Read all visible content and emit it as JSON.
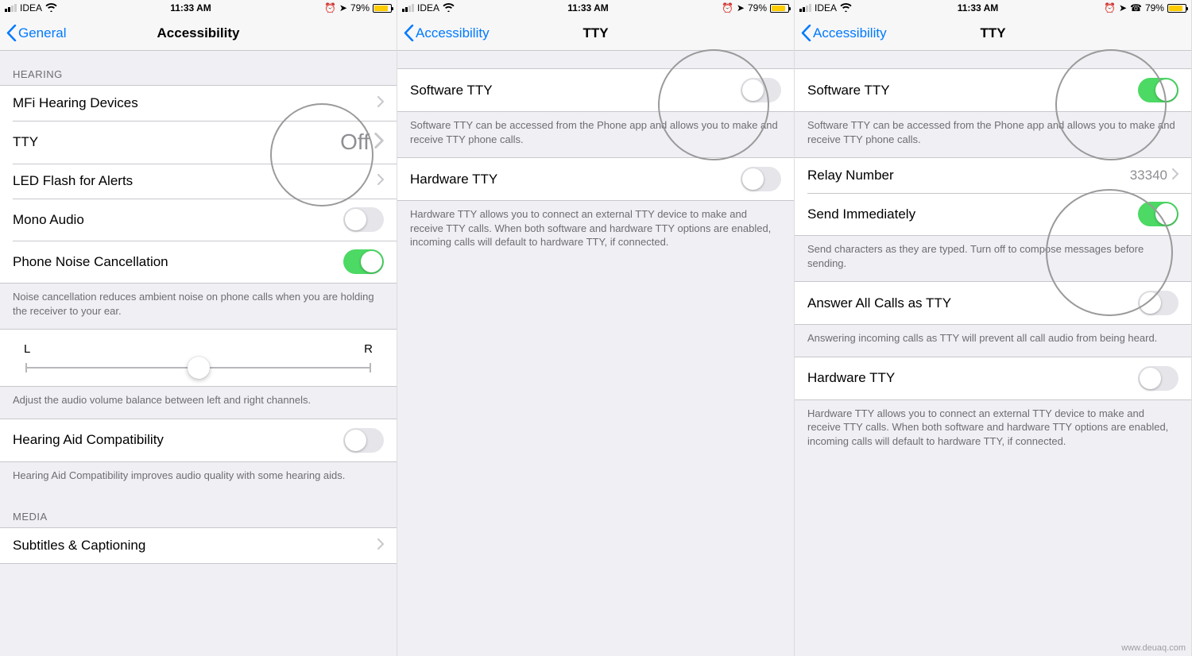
{
  "status": {
    "carrier": "IDEA",
    "time": "11:33 AM",
    "battery_pct": "79%"
  },
  "screen1": {
    "back": "General",
    "title": "Accessibility",
    "section_hearing": "HEARING",
    "mfi": "MFi Hearing Devices",
    "tty": "TTY",
    "tty_value": "Off",
    "led": "LED Flash for Alerts",
    "mono": "Mono Audio",
    "noise": "Phone Noise Cancellation",
    "noise_footer": "Noise cancellation reduces ambient noise on phone calls when you are holding the receiver to your ear.",
    "slider_left": "L",
    "slider_right": "R",
    "slider_footer": "Adjust the audio volume balance between left and right channels.",
    "hearing_aid": "Hearing Aid Compatibility",
    "hearing_aid_footer": "Hearing Aid Compatibility improves audio quality with some hearing aids.",
    "section_media": "MEDIA",
    "subtitles": "Subtitles & Captioning"
  },
  "screen2": {
    "back": "Accessibility",
    "title": "TTY",
    "software_tty": "Software TTY",
    "software_footer": "Software TTY can be accessed from the Phone app and allows you to make and receive TTY phone calls.",
    "hardware_tty": "Hardware TTY",
    "hardware_footer": "Hardware TTY allows you to connect an external TTY device to make and receive TTY calls. When both software and hardware TTY options are enabled, incoming calls will default to hardware TTY, if connected."
  },
  "screen3": {
    "back": "Accessibility",
    "title": "TTY",
    "software_tty": "Software TTY",
    "software_footer": "Software TTY can be accessed from the Phone app and allows you to make and receive TTY phone calls.",
    "relay": "Relay Number",
    "relay_value": "33340",
    "send_immediately": "Send Immediately",
    "send_footer": "Send characters as they are typed. Turn off to compose messages before sending.",
    "answer_all": "Answer All Calls as TTY",
    "answer_footer": "Answering incoming calls as TTY will prevent all call audio from being heard.",
    "hardware_tty": "Hardware TTY",
    "hardware_footer": "Hardware TTY allows you to connect an external TTY device to make and receive TTY calls. When both software and hardware TTY options are enabled, incoming calls will default to hardware TTY, if connected."
  },
  "watermark": "www.deuaq.com"
}
